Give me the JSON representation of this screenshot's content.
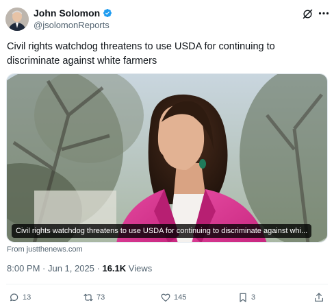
{
  "author": {
    "name": "John Solomon",
    "handle": "@jsolomonReports",
    "verified_color": "#1d9bf0"
  },
  "post": {
    "text": "Civil rights watchdog threatens to use USDA for continuing to discriminate against white farmers",
    "media_caption": "Civil rights watchdog threatens to use USDA for continuing to discriminate against whi...",
    "source": "From justthenews.com",
    "timestamp": "8:00 PM · Jun 1, 2025 · ",
    "views_count": "16.1K",
    "views_label": " Views"
  },
  "actions": {
    "replies": "13",
    "reposts": "73",
    "likes": "145",
    "bookmarks": "3"
  },
  "icons": [
    "grok-icon",
    "more-icon",
    "reply-icon",
    "repost-icon",
    "like-icon",
    "bookmark-icon",
    "share-icon",
    "verified-badge-icon"
  ]
}
